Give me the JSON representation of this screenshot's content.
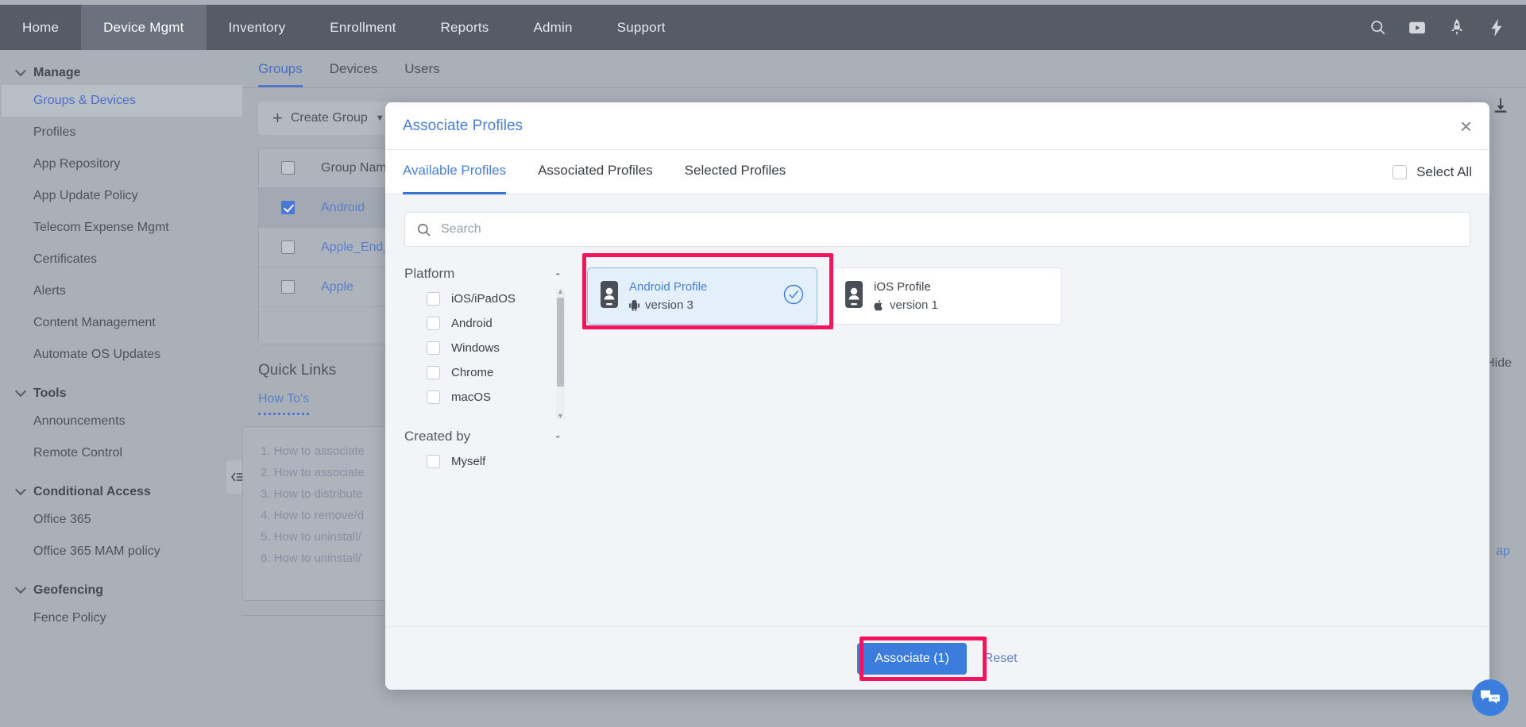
{
  "topnav": {
    "items": [
      {
        "label": "Home",
        "active": false
      },
      {
        "label": "Device Mgmt",
        "active": true
      },
      {
        "label": "Inventory",
        "active": false
      },
      {
        "label": "Enrollment",
        "active": false
      },
      {
        "label": "Reports",
        "active": false
      },
      {
        "label": "Admin",
        "active": false
      },
      {
        "label": "Support",
        "active": false
      }
    ],
    "icons": [
      "search-icon",
      "video-icon",
      "rocket-icon",
      "lightning-icon"
    ]
  },
  "sidebar": {
    "groups": [
      {
        "title": "Manage",
        "items": [
          {
            "label": "Groups & Devices",
            "active": true
          },
          {
            "label": "Profiles",
            "active": false
          },
          {
            "label": "App Repository",
            "active": false
          },
          {
            "label": "App Update Policy",
            "active": false
          },
          {
            "label": "Telecom Expense Mgmt",
            "active": false
          },
          {
            "label": "Certificates",
            "active": false
          },
          {
            "label": "Alerts",
            "active": false
          },
          {
            "label": "Content Management",
            "active": false
          },
          {
            "label": "Automate OS Updates",
            "active": false
          }
        ]
      },
      {
        "title": "Tools",
        "items": [
          {
            "label": "Announcements",
            "active": false
          },
          {
            "label": "Remote Control",
            "active": false
          }
        ]
      },
      {
        "title": "Conditional Access",
        "items": [
          {
            "label": "Office 365",
            "active": false
          },
          {
            "label": "Office 365 MAM policy",
            "active": false
          }
        ]
      },
      {
        "title": "Geofencing",
        "items": [
          {
            "label": "Fence Policy",
            "active": false
          }
        ]
      }
    ]
  },
  "main": {
    "tabs": [
      {
        "label": "Groups",
        "active": true
      },
      {
        "label": "Devices",
        "active": false
      },
      {
        "label": "Users",
        "active": false
      }
    ],
    "create_group_label": "Create Group",
    "table": {
      "header": "Group Name",
      "rows": [
        {
          "name": "Android",
          "checked": true,
          "selected": true
        },
        {
          "name": "Apple_End_U",
          "checked": false,
          "selected": false
        },
        {
          "name": "Apple",
          "checked": false,
          "selected": false
        }
      ]
    },
    "pager_label": "›",
    "hide_label": "Hide",
    "map_label": "ap",
    "quick_links": {
      "title": "Quick Links",
      "tab": "How To's",
      "items": [
        "1. How to associate",
        "2. How to associate",
        "3. How to distribute",
        "4. How to remove/d",
        "5. How to uninstall/",
        "6. How to uninstall/"
      ]
    }
  },
  "modal": {
    "title": "Associate Profiles",
    "close_label": "×",
    "tabs": [
      {
        "label": "Available Profiles",
        "active": true
      },
      {
        "label": "Associated Profiles",
        "active": false
      },
      {
        "label": "Selected Profiles",
        "active": false
      }
    ],
    "select_all_label": "Select All",
    "select_all_checked": false,
    "search": {
      "value": "",
      "placeholder": "Search"
    },
    "filters": [
      {
        "title": "Platform",
        "collapse_label": "-",
        "options": [
          {
            "label": "iOS/iPadOS",
            "checked": false
          },
          {
            "label": "Android",
            "checked": false
          },
          {
            "label": "Windows",
            "checked": false
          },
          {
            "label": "Chrome",
            "checked": false
          },
          {
            "label": "macOS",
            "checked": false
          }
        ]
      },
      {
        "title": "Created by",
        "collapse_label": "-",
        "options": [
          {
            "label": "Myself",
            "checked": false
          }
        ]
      }
    ],
    "profiles": [
      {
        "name": "Android Profile",
        "version": "version 3",
        "platform": "android",
        "selected": true
      },
      {
        "name": "iOS Profile",
        "version": "version 1",
        "platform": "apple",
        "selected": false
      }
    ],
    "footer": {
      "associate_label": "Associate (1)",
      "reset_label": "Reset"
    }
  },
  "colors": {
    "accent_blue": "#3b7ddd",
    "link_blue": "#4a7fd4",
    "highlight_pink": "#f4145b",
    "topnav_bg": "#555c66",
    "page_bg": "#aab0b8"
  }
}
